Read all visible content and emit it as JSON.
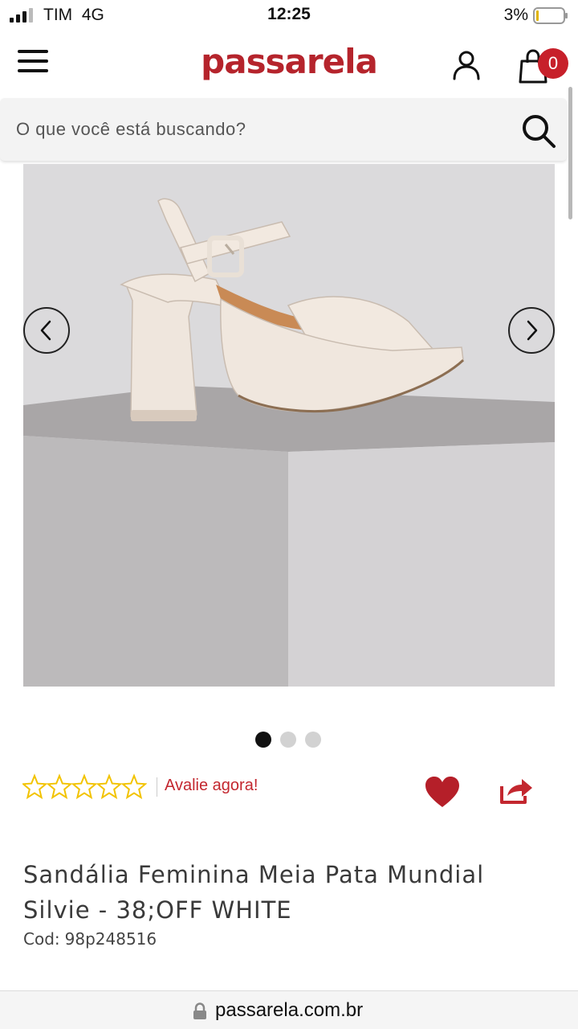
{
  "status_bar": {
    "carrier": "TIM",
    "network": "4G",
    "time": "12:25",
    "battery": "3%"
  },
  "header": {
    "brand": "passarela",
    "cart_count": "0",
    "brand_color": "#b5242c"
  },
  "search": {
    "placeholder": "O que você está buscando?",
    "value": ""
  },
  "gallery": {
    "image_count": 3,
    "active_index": 0
  },
  "rating": {
    "stars_filled": 0,
    "stars_total": 5,
    "review_label": "Avalie agora!",
    "star_color": "#f2c300"
  },
  "product": {
    "title": "Sandália Feminina Meia Pata Mundial Silvie - 38;OFF WHITE",
    "code_label": "Cod:",
    "code_value": "98p248516"
  },
  "browser": {
    "url": "passarela.com.br"
  },
  "icons": {
    "menu": "hamburger-icon",
    "account": "user-icon",
    "cart": "shopping-bag-icon",
    "search": "search-icon",
    "prev": "chevron-left-icon",
    "next": "chevron-right-icon",
    "wishlist": "heart-icon",
    "share": "share-icon",
    "lock": "lock-icon"
  },
  "colors": {
    "accent": "#c3272f",
    "heart": "#b51f29"
  }
}
